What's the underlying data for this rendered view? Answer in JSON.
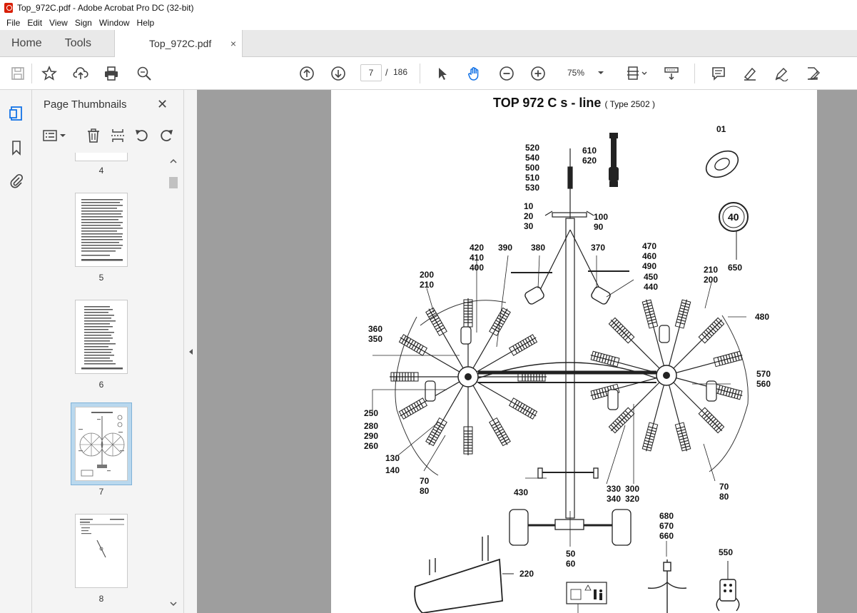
{
  "window": {
    "title": "Top_972C.pdf - Adobe Acrobat Pro DC (32-bit)"
  },
  "menu": [
    "File",
    "Edit",
    "View",
    "Sign",
    "Window",
    "Help"
  ],
  "tabs": {
    "home": "Home",
    "tools": "Tools",
    "document": "Top_972C.pdf",
    "close": "×"
  },
  "toolbar": {
    "page_current": "7",
    "page_separator": "/",
    "page_total": "186",
    "zoom": "75%"
  },
  "sidebar": {
    "title": "Page Thumbnails",
    "close": "✕",
    "thumbnails": [
      {
        "label": "4"
      },
      {
        "label": "5"
      },
      {
        "label": "6"
      },
      {
        "label": "7",
        "selected": true
      },
      {
        "label": "8"
      }
    ]
  },
  "page": {
    "title": "TOP 972  C s - line",
    "subtitle": "( Type 2502 )",
    "labels": {
      "l01": "01",
      "l40": "40",
      "l650": "650",
      "l520": "520\n540\n500\n510\n530",
      "l610": "610\n620",
      "l10": "10\n20\n30",
      "l100": "100\n90",
      "l420": "420\n410\n400",
      "l390": "390",
      "l380": "380",
      "l370": "370",
      "l470": "470\n460\n490",
      "l450": "450\n440",
      "l210r": "210\n200",
      "l200l": "200\n210",
      "l480": "480",
      "l360": "360\n350",
      "l570": "570\n560",
      "l250": "250",
      "l280": "280\n290\n260",
      "l130": "130",
      "l140": "140",
      "l70l": "70\n80",
      "l430": "430",
      "l330": "330\n340",
      "l300": "300\n320",
      "l70r": "70\n80",
      "l50": "50\n60",
      "l680": "680\n670\n660",
      "l550": "550",
      "l220": "220"
    }
  }
}
